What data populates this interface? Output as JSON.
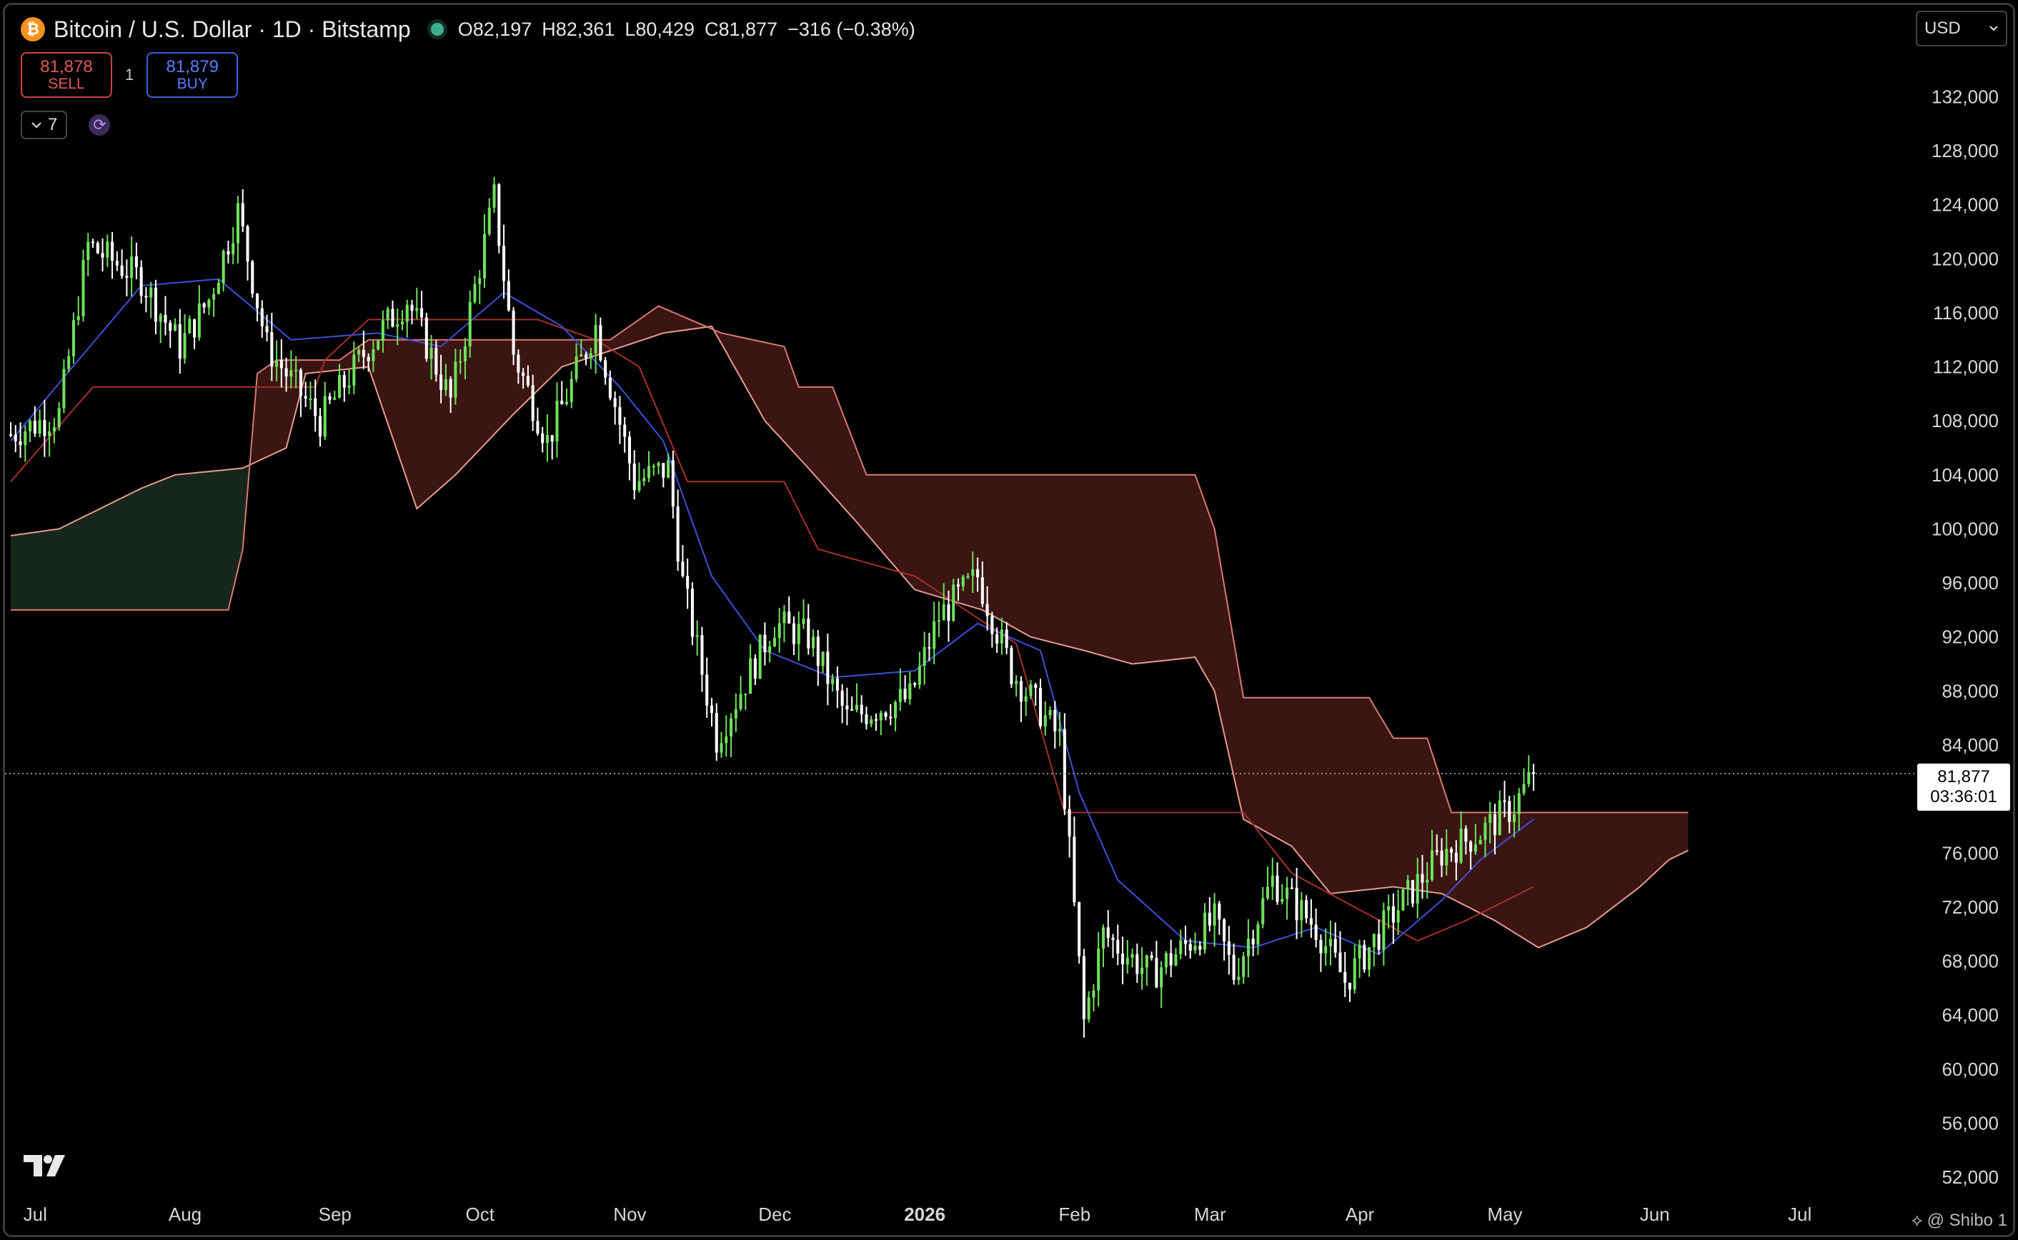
{
  "header": {
    "coin_glyph": "₿",
    "title": "Bitcoin / U.S. Dollar · 1D · Bitstamp",
    "open": "O82,197",
    "high": "H82,361",
    "low": "L80,429",
    "close": "C81,877",
    "change": "−316 (−0.38%)"
  },
  "trade": {
    "sell_price": "81,878",
    "sell_label": "SELL",
    "quantity": "1",
    "buy_price": "81,879",
    "buy_label": "BUY"
  },
  "indicators": {
    "count": "7"
  },
  "currency": {
    "label": "USD"
  },
  "last_price": {
    "value": "81,877",
    "countdown": "03:36:01"
  },
  "credit": "@ Shibo 1",
  "colors": {
    "background": "#000000",
    "up_candle": "#6fe05c",
    "down_candle": "#ffffff",
    "tenkan": "#3e4fd6",
    "kijun": "#a5302b",
    "cloud_bull": "#17261a",
    "cloud_bear": "#3a1512",
    "span_a": "#e69c90",
    "span_b": "#d97a72"
  },
  "chart_data": {
    "type": "candlestick",
    "indicator": "Ichimoku Cloud",
    "y_axis": {
      "ticks": [
        132000,
        128000,
        124000,
        120000,
        116000,
        112000,
        108000,
        104000,
        100000,
        96000,
        92000,
        88000,
        84000,
        80000,
        76000,
        72000,
        68000,
        64000,
        60000,
        56000,
        52000
      ],
      "tick_labels": [
        "132,000",
        "128,000",
        "124,000",
        "120,000",
        "116,000",
        "112,000",
        "108,000",
        "104,000",
        "100,000",
        "96,000",
        "92,000",
        "88,000",
        "84,000",
        "80,000",
        "76,000",
        "72,000",
        "68,000",
        "64,000",
        "60,000",
        "56,000",
        "52,000"
      ],
      "range": [
        51000,
        133500
      ],
      "scale": "linear"
    },
    "x_axis": {
      "range": [
        "2025-06-28",
        "2026-07-25"
      ],
      "ticks": [
        {
          "date": "2025-07-01",
          "label": "Jul",
          "bold": false
        },
        {
          "date": "2025-08-01",
          "label": "Aug",
          "bold": false
        },
        {
          "date": "2025-09-01",
          "label": "Sep",
          "bold": false
        },
        {
          "date": "2025-10-01",
          "label": "Oct",
          "bold": false
        },
        {
          "date": "2025-11-01",
          "label": "Nov",
          "bold": false
        },
        {
          "date": "2025-12-01",
          "label": "Dec",
          "bold": false
        },
        {
          "date": "2026-01-01",
          "label": "2026",
          "bold": true
        },
        {
          "date": "2026-02-01",
          "label": "Feb",
          "bold": false
        },
        {
          "date": "2026-03-01",
          "label": "Mar",
          "bold": false
        },
        {
          "date": "2026-04-01",
          "label": "Apr",
          "bold": false
        },
        {
          "date": "2026-05-01",
          "label": "May",
          "bold": false
        },
        {
          "date": "2026-06-01",
          "label": "Jun",
          "bold": false
        },
        {
          "date": "2026-07-01",
          "label": "Jul",
          "bold": false
        }
      ]
    },
    "price_anchors": [
      {
        "date": "2025-06-28",
        "close": 107000
      },
      {
        "date": "2025-07-08",
        "close": 108500
      },
      {
        "date": "2025-07-14",
        "close": 121000
      },
      {
        "date": "2025-07-25",
        "close": 118500
      },
      {
        "date": "2025-08-02",
        "close": 113500
      },
      {
        "date": "2025-08-08",
        "close": 117000
      },
      {
        "date": "2025-08-14",
        "close": 123500
      },
      {
        "date": "2025-08-20",
        "close": 113500
      },
      {
        "date": "2025-08-31",
        "close": 108000
      },
      {
        "date": "2025-09-10",
        "close": 113500
      },
      {
        "date": "2025-09-18",
        "close": 117000
      },
      {
        "date": "2025-09-27",
        "close": 109500
      },
      {
        "date": "2025-10-06",
        "close": 124500
      },
      {
        "date": "2025-10-10",
        "close": 113000
      },
      {
        "date": "2025-10-17",
        "close": 106500
      },
      {
        "date": "2025-10-27",
        "close": 115000
      },
      {
        "date": "2025-11-04",
        "close": 103500
      },
      {
        "date": "2025-11-11",
        "close": 104500
      },
      {
        "date": "2025-11-14",
        "close": 96000
      },
      {
        "date": "2025-11-21",
        "close": 84500
      },
      {
        "date": "2025-12-03",
        "close": 93000
      },
      {
        "date": "2025-12-10",
        "close": 92000
      },
      {
        "date": "2025-12-18",
        "close": 86000
      },
      {
        "date": "2025-12-31",
        "close": 87500
      },
      {
        "date": "2026-01-06",
        "close": 93500
      },
      {
        "date": "2026-01-14",
        "close": 96500
      },
      {
        "date": "2026-01-21",
        "close": 89500
      },
      {
        "date": "2026-01-31",
        "close": 84500
      },
      {
        "date": "2026-02-05",
        "close": 63500
      },
      {
        "date": "2026-02-09",
        "close": 70000
      },
      {
        "date": "2026-02-19",
        "close": 67000
      },
      {
        "date": "2026-03-04",
        "close": 71000
      },
      {
        "date": "2026-03-08",
        "close": 67000
      },
      {
        "date": "2026-03-16",
        "close": 74000
      },
      {
        "date": "2026-03-25",
        "close": 70500
      },
      {
        "date": "2026-03-31",
        "close": 66500
      },
      {
        "date": "2026-04-10",
        "close": 71500
      },
      {
        "date": "2026-04-20",
        "close": 76000
      },
      {
        "date": "2026-04-28",
        "close": 77500
      },
      {
        "date": "2026-05-05",
        "close": 79500
      },
      {
        "date": "2026-05-09",
        "close": 81877
      }
    ],
    "tenkan_anchors": [
      {
        "date": "2025-06-28",
        "value": 106500
      },
      {
        "date": "2025-07-12",
        "value": 112500
      },
      {
        "date": "2025-07-25",
        "value": 118000
      },
      {
        "date": "2025-08-10",
        "value": 118500
      },
      {
        "date": "2025-08-25",
        "value": 114000
      },
      {
        "date": "2025-09-12",
        "value": 114500
      },
      {
        "date": "2025-09-25",
        "value": 113500
      },
      {
        "date": "2025-10-08",
        "value": 117500
      },
      {
        "date": "2025-10-20",
        "value": 115000
      },
      {
        "date": "2025-11-01",
        "value": 110500
      },
      {
        "date": "2025-11-10",
        "value": 106500
      },
      {
        "date": "2025-11-20",
        "value": 96500
      },
      {
        "date": "2025-12-01",
        "value": 91000
      },
      {
        "date": "2025-12-15",
        "value": 89000
      },
      {
        "date": "2026-01-01",
        "value": 89500
      },
      {
        "date": "2026-01-14",
        "value": 93000
      },
      {
        "date": "2026-01-27",
        "value": 91000
      },
      {
        "date": "2026-02-04",
        "value": 80500
      },
      {
        "date": "2026-02-12",
        "value": 74000
      },
      {
        "date": "2026-02-26",
        "value": 69500
      },
      {
        "date": "2026-03-12",
        "value": 69000
      },
      {
        "date": "2026-03-25",
        "value": 70500
      },
      {
        "date": "2026-04-07",
        "value": 68500
      },
      {
        "date": "2026-04-20",
        "value": 72500
      },
      {
        "date": "2026-04-28",
        "value": 75500
      },
      {
        "date": "2026-05-09",
        "value": 78500
      }
    ],
    "kijun_anchors": [
      {
        "date": "2025-06-28",
        "value": 103500
      },
      {
        "date": "2025-07-15",
        "value": 110500
      },
      {
        "date": "2025-08-30",
        "value": 110500
      },
      {
        "date": "2025-09-01",
        "value": 112500
      },
      {
        "date": "2025-09-10",
        "value": 115500
      },
      {
        "date": "2025-10-15",
        "value": 115500
      },
      {
        "date": "2025-10-27",
        "value": 114000
      },
      {
        "date": "2025-11-05",
        "value": 112000
      },
      {
        "date": "2025-11-15",
        "value": 103500
      },
      {
        "date": "2025-12-05",
        "value": 103500
      },
      {
        "date": "2025-12-12",
        "value": 98500
      },
      {
        "date": "2026-01-01",
        "value": 96500
      },
      {
        "date": "2026-01-22",
        "value": 91500
      },
      {
        "date": "2026-02-01",
        "value": 79000
      },
      {
        "date": "2026-03-10",
        "value": 79000
      },
      {
        "date": "2026-03-20",
        "value": 74500
      },
      {
        "date": "2026-04-15",
        "value": 69500
      },
      {
        "date": "2026-04-25",
        "value": 71000
      },
      {
        "date": "2026-05-09",
        "value": 73500
      }
    ],
    "span_a_anchors": [
      {
        "date": "2025-06-28",
        "value": 99500
      },
      {
        "date": "2025-07-08",
        "value": 100000
      },
      {
        "date": "2025-07-25",
        "value": 103000
      },
      {
        "date": "2025-08-01",
        "value": 104000
      },
      {
        "date": "2025-08-15",
        "value": 104500
      },
      {
        "date": "2025-08-24",
        "value": 106000
      },
      {
        "date": "2025-08-28",
        "value": 111500
      },
      {
        "date": "2025-09-10",
        "value": 112000
      },
      {
        "date": "2025-09-20",
        "value": 101500
      },
      {
        "date": "2025-09-28",
        "value": 104000
      },
      {
        "date": "2025-10-10",
        "value": 108500
      },
      {
        "date": "2025-10-20",
        "value": 112000
      },
      {
        "date": "2025-11-10",
        "value": 114500
      },
      {
        "date": "2025-11-20",
        "value": 115000
      },
      {
        "date": "2025-12-01",
        "value": 108000
      },
      {
        "date": "2025-12-10",
        "value": 104500
      },
      {
        "date": "2025-12-20",
        "value": 100500
      },
      {
        "date": "2026-01-01",
        "value": 95500
      },
      {
        "date": "2026-01-15",
        "value": 94000
      },
      {
        "date": "2026-01-25",
        "value": 92000
      },
      {
        "date": "2026-02-05",
        "value": 91000
      },
      {
        "date": "2026-02-15",
        "value": 90000
      },
      {
        "date": "2026-02-28",
        "value": 90500
      },
      {
        "date": "2026-03-04",
        "value": 88000
      },
      {
        "date": "2026-03-10",
        "value": 78500
      },
      {
        "date": "2026-03-20",
        "value": 76500
      },
      {
        "date": "2026-03-28",
        "value": 73000
      },
      {
        "date": "2026-04-10",
        "value": 73500
      },
      {
        "date": "2026-04-20",
        "value": 73000
      },
      {
        "date": "2026-05-01",
        "value": 71000
      },
      {
        "date": "2026-05-10",
        "value": 69000
      },
      {
        "date": "2026-05-20",
        "value": 70500
      },
      {
        "date": "2026-05-31",
        "value": 73500
      },
      {
        "date": "2026-06-06",
        "value": 75500
      },
      {
        "date": "2026-06-10",
        "value": 76200
      }
    ],
    "span_b_anchors": [
      {
        "date": "2025-06-28",
        "value": 94000
      },
      {
        "date": "2025-08-12",
        "value": 94000
      },
      {
        "date": "2025-08-15",
        "value": 98500
      },
      {
        "date": "2025-08-18",
        "value": 111500
      },
      {
        "date": "2025-08-22",
        "value": 112500
      },
      {
        "date": "2025-09-04",
        "value": 112500
      },
      {
        "date": "2025-09-10",
        "value": 114000
      },
      {
        "date": "2025-10-05",
        "value": 114000
      },
      {
        "date": "2025-10-30",
        "value": 114000
      },
      {
        "date": "2025-11-09",
        "value": 116500
      },
      {
        "date": "2025-11-22",
        "value": 114500
      },
      {
        "date": "2025-12-05",
        "value": 113500
      },
      {
        "date": "2025-12-08",
        "value": 110500
      },
      {
        "date": "2025-12-15",
        "value": 110500
      },
      {
        "date": "2025-12-22",
        "value": 104000
      },
      {
        "date": "2026-02-28",
        "value": 104000
      },
      {
        "date": "2026-03-04",
        "value": 100000
      },
      {
        "date": "2026-03-10",
        "value": 87500
      },
      {
        "date": "2026-04-05",
        "value": 87500
      },
      {
        "date": "2026-04-10",
        "value": 84500
      },
      {
        "date": "2026-04-17",
        "value": 84500
      },
      {
        "date": "2026-04-22",
        "value": 79000
      },
      {
        "date": "2026-06-10",
        "value": 79000
      }
    ],
    "last_price": 81877
  }
}
